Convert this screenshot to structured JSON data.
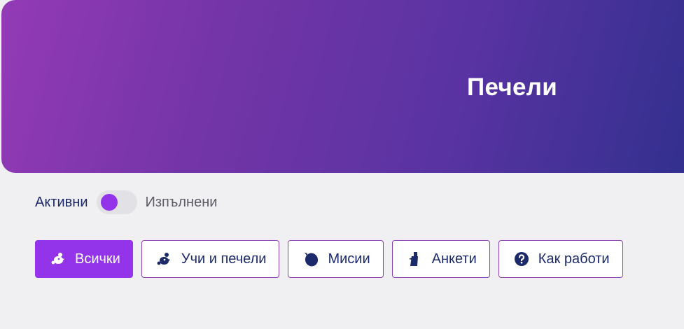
{
  "hero": {
    "title": "Печели"
  },
  "filter": {
    "active_label": "Активни",
    "completed_label": "Изпълнени",
    "toggle_state": "active"
  },
  "tabs": [
    {
      "label": "Всички",
      "icon": "all-icon",
      "selected": true
    },
    {
      "label": "Учи и печели",
      "icon": "learn-earn-icon",
      "selected": false
    },
    {
      "label": "Мисии",
      "icon": "missions-icon",
      "selected": false
    },
    {
      "label": "Анкети",
      "icon": "surveys-icon",
      "selected": false
    },
    {
      "label": "Как работи",
      "icon": "question-icon",
      "selected": false
    }
  ],
  "colors": {
    "accent": "#9333ea",
    "text_dark": "#1c2a6b",
    "hero_start": "#943ab7",
    "hero_end": "#33308f"
  }
}
